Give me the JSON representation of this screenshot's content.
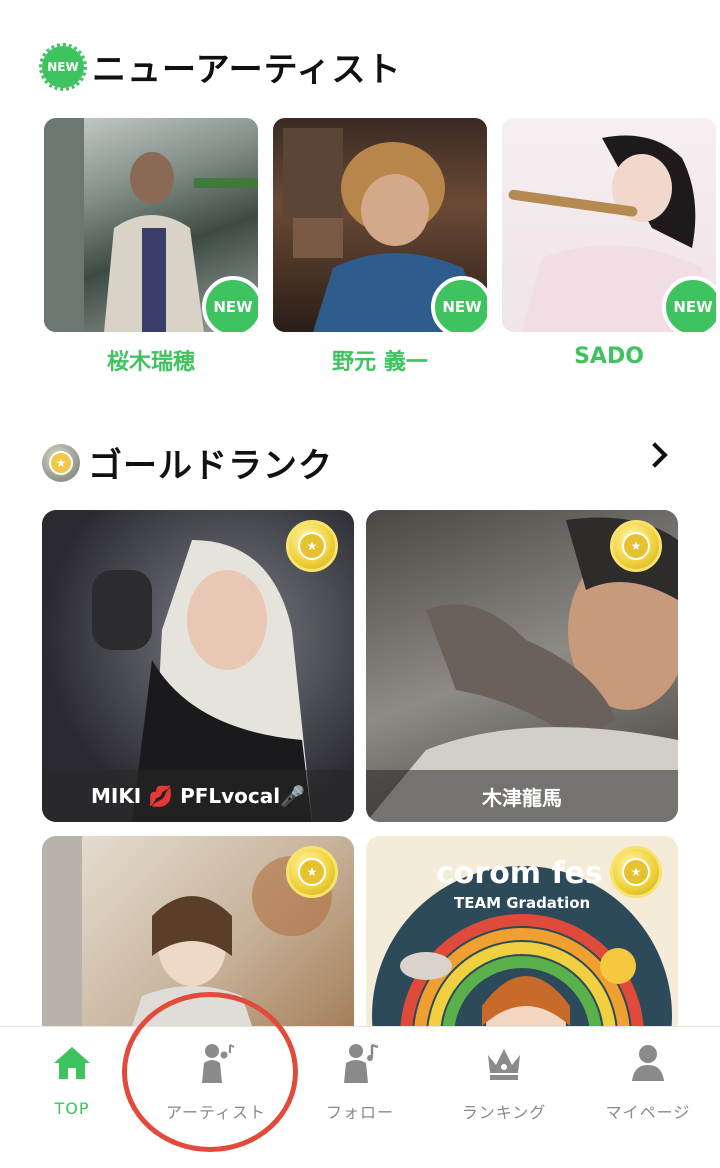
{
  "new_artists": {
    "title": "ニューアーティスト",
    "badge_text": "NEW",
    "items": [
      {
        "name": "桜木瑞穂",
        "badge": "NEW"
      },
      {
        "name": "野元 義一",
        "badge": "NEW"
      },
      {
        "name": "SADO",
        "badge": "NEW"
      }
    ]
  },
  "gold_rank": {
    "title": "ゴールドランク",
    "items": [
      {
        "name": "MIKI 💋 PFLvocal🎤"
      },
      {
        "name": "木津龍馬"
      },
      {
        "name": ""
      },
      {
        "name": ""
      }
    ],
    "cover_text_line1": "corom fes",
    "cover_text_line2": "TEAM Gradation"
  },
  "tabbar": {
    "items": [
      {
        "label": "TOP",
        "icon": "home-icon",
        "active": true
      },
      {
        "label": "アーティスト",
        "icon": "singer-icon",
        "active": false
      },
      {
        "label": "フォロー",
        "icon": "follow-icon",
        "active": false
      },
      {
        "label": "ランキング",
        "icon": "crown-icon",
        "active": false
      },
      {
        "label": "マイページ",
        "icon": "person-icon",
        "active": false
      }
    ]
  },
  "colors": {
    "accent": "#3fc35f",
    "gold": "#f1d33c",
    "highlight": "#e24a3b"
  }
}
